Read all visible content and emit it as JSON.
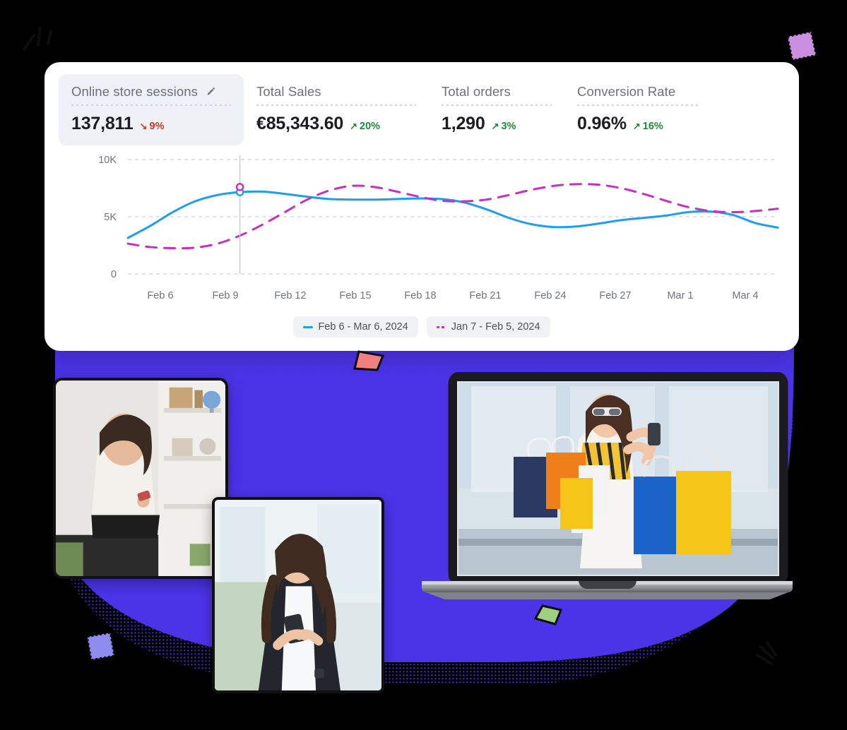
{
  "dashboard": {
    "kpis": [
      {
        "label": "Online store sessions",
        "value": "137,811",
        "delta": "9%",
        "direction": "down",
        "arrow": "↘",
        "editable": true,
        "edit_icon": "pencil-icon",
        "active": true
      },
      {
        "label": "Total Sales",
        "value": "€85,343.60",
        "delta": "20%",
        "direction": "up",
        "arrow": "↗",
        "editable": false,
        "active": false
      },
      {
        "label": "Total orders",
        "value": "1,290",
        "delta": "3%",
        "direction": "up",
        "arrow": "↗",
        "editable": false,
        "active": false
      },
      {
        "label": "Conversion Rate",
        "value": "0.96%",
        "delta": "16%",
        "direction": "up",
        "arrow": "↗",
        "editable": false,
        "active": false
      }
    ],
    "legend": [
      {
        "label": "Feb 6 - Mar 6, 2024",
        "style": "solid",
        "color": "#1f9df0"
      },
      {
        "label": "Jan 7 - Feb 5, 2024",
        "style": "dashed",
        "color": "#c72fc0"
      }
    ]
  },
  "chart_data": {
    "type": "line",
    "title": "",
    "xlabel": "",
    "ylabel": "",
    "ylim": [
      0,
      10000
    ],
    "yticks": [
      0,
      5000,
      10000
    ],
    "ytick_labels": [
      "0",
      "5K",
      "10K"
    ],
    "grid": true,
    "legend_position": "bottom",
    "categories": [
      "Feb 6",
      "Feb 9",
      "Feb 12",
      "Feb 15",
      "Feb 18",
      "Feb 21",
      "Feb 24",
      "Feb 27",
      "Mar 1",
      "Mar 4"
    ],
    "x": [
      "Feb 6",
      "Feb 7",
      "Feb 8",
      "Feb 9",
      "Feb 10",
      "Feb 11",
      "Feb 12",
      "Feb 13",
      "Feb 14",
      "Feb 15",
      "Feb 16",
      "Feb 17",
      "Feb 18",
      "Feb 19",
      "Feb 20",
      "Feb 21",
      "Feb 22",
      "Feb 23",
      "Feb 24",
      "Feb 25",
      "Feb 26",
      "Feb 27",
      "Feb 28",
      "Feb 29",
      "Mar 1",
      "Mar 2",
      "Mar 3",
      "Mar 4",
      "Mar 5",
      "Mar 6"
    ],
    "series": [
      {
        "name": "Feb 6 - Mar 6, 2024",
        "style": "solid",
        "color": "#1f9df0",
        "values": [
          3150,
          4200,
          5400,
          6350,
          6900,
          7150,
          7200,
          7000,
          6750,
          6550,
          6500,
          6500,
          6550,
          6600,
          6550,
          6250,
          5650,
          4900,
          4350,
          4100,
          4150,
          4400,
          4700,
          4900,
          5100,
          5400,
          5450,
          5150,
          4450,
          4050
        ]
      },
      {
        "name": "Jan 7 - Feb 5, 2024",
        "style": "dashed",
        "color": "#c72fc0",
        "values": [
          2650,
          2350,
          2250,
          2300,
          2650,
          3350,
          4300,
          5400,
          6500,
          7300,
          7700,
          7600,
          7200,
          6750,
          6400,
          6350,
          6500,
          6900,
          7350,
          7700,
          7850,
          7800,
          7500,
          7000,
          6400,
          5850,
          5500,
          5400,
          5500,
          5700
        ]
      }
    ],
    "cursor": {
      "x_position": "Feb 11",
      "markers": [
        {
          "series": "Feb 6 - Mar 6, 2024",
          "value": 7150,
          "color": "#1f9df0"
        },
        {
          "series": "Jan 7 - Feb 5, 2024",
          "value": 7600,
          "color": "#c72fc0"
        }
      ]
    }
  },
  "decor": {
    "blob_color": "#4b33e8",
    "square_purple": "#cb8ee0",
    "square_blue": "#8f8cf0",
    "shape_coral": "#f08080",
    "shape_green": "#9dd07e"
  }
}
